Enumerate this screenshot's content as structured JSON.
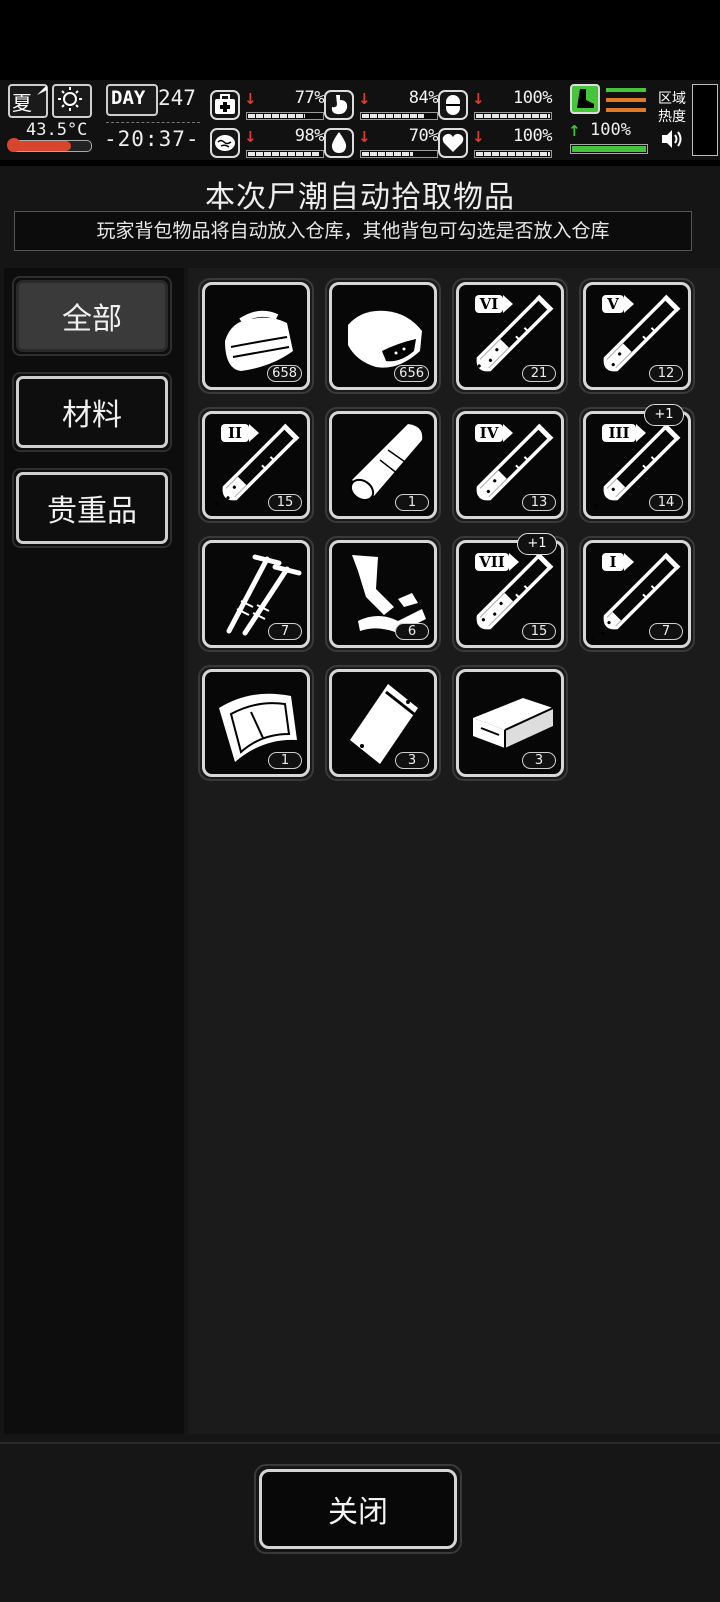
{
  "hud": {
    "season": "夏",
    "temperature": "43.5°C",
    "temperature_level": 0.75,
    "day_label": "DAY",
    "day_number": "247",
    "time": "-20:37-",
    "stats": [
      {
        "icon": "medkit-icon",
        "trend": "down",
        "value": "77%",
        "level": 0.77
      },
      {
        "icon": "stomach-icon",
        "trend": "down",
        "value": "84%",
        "level": 0.84
      },
      {
        "icon": "capsule-icon",
        "trend": "down",
        "value": "100%",
        "level": 1.0
      },
      {
        "icon": "brain-icon",
        "trend": "down",
        "value": "98%",
        "level": 0.98
      },
      {
        "icon": "water-drop-icon",
        "trend": "down",
        "value": "70%",
        "level": 0.7
      },
      {
        "icon": "heart-icon",
        "trend": "down",
        "value": "100%",
        "level": 1.0
      }
    ],
    "stamina": {
      "trend": "up",
      "value": "100%",
      "level": 1.0
    },
    "region_heat_label": [
      "区域",
      "热度"
    ],
    "colors": {
      "down_arrow": "#e23b2e",
      "up_arrow": "#3fc23a",
      "stamina_green": "#45c43c",
      "stamina_orange": "#e07a2a",
      "thermo_red": "#d9452c"
    }
  },
  "panel": {
    "title": "本次尸潮自动拾取物品",
    "subtitle": "玩家背包物品将自动放入仓库，其他背包可勾选是否放入仓库"
  },
  "tabs": [
    {
      "label": "全部",
      "active": true
    },
    {
      "label": "材料",
      "active": false
    },
    {
      "label": "贵重品",
      "active": false
    }
  ],
  "items": [
    {
      "icon": "cloth-icon",
      "count": "658"
    },
    {
      "icon": "meat-icon",
      "count": "656"
    },
    {
      "icon": "test-tube-icon",
      "grade": "VI",
      "fill": 0.55,
      "count": "21"
    },
    {
      "icon": "test-tube-icon",
      "grade": "V",
      "fill": 0.45,
      "count": "12"
    },
    {
      "icon": "test-tube-icon",
      "grade": "II",
      "fill": 0.35,
      "count": "15"
    },
    {
      "icon": "bandage-roll-icon",
      "count": "1"
    },
    {
      "icon": "test-tube-icon",
      "grade": "IV",
      "fill": 0.5,
      "count": "13"
    },
    {
      "icon": "test-tube-icon",
      "grade": "III",
      "fill": 0.3,
      "count": "14",
      "bonus": "+1"
    },
    {
      "icon": "nails-icon",
      "count": "7"
    },
    {
      "icon": "scrap-metal-icon",
      "count": "6"
    },
    {
      "icon": "test-tube-icon",
      "grade": "VII",
      "fill": 0.65,
      "count": "15",
      "bonus": "+1"
    },
    {
      "icon": "test-tube-icon",
      "grade": "I",
      "fill": 0.2,
      "count": "7"
    },
    {
      "icon": "glass-sheet-icon",
      "count": "1"
    },
    {
      "icon": "plastic-bag-icon",
      "count": "3"
    },
    {
      "icon": "brick-icon",
      "count": "3"
    }
  ],
  "footer": {
    "close_label": "关闭"
  }
}
